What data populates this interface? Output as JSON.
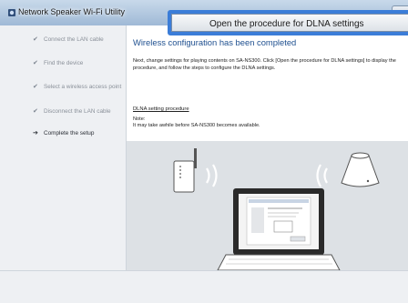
{
  "window": {
    "title": "Network Speaker Wi-Fi Utility",
    "icon": "app-speaker-icon"
  },
  "steps": [
    {
      "label": "Connect the LAN cable",
      "state": "done",
      "icon": "checkmark-icon"
    },
    {
      "label": "Find the device",
      "state": "done",
      "icon": "checkmark-icon"
    },
    {
      "label": "Select a wireless access point",
      "state": "done",
      "icon": "checkmark-icon"
    },
    {
      "label": "Disconnect the LAN cable",
      "state": "done",
      "icon": "checkmark-icon"
    },
    {
      "label": "Complete the setup",
      "state": "current",
      "icon": "arrow-right-icon"
    }
  ],
  "main": {
    "heading": "Wireless configuration has been completed",
    "paragraph": "Next, change settings for playing contents on SA-NS300. Click [Open the procedure for DLNA settings] to display the procedure, and follow the steps to configure the DLNA settings.",
    "link": "DLNA setting procedure",
    "note_label": "Note:",
    "note_text": "It may take awhile before SA-NS300 becomes available."
  },
  "buttons": {
    "open_dlna": "Open the procedure for DLNA settings"
  },
  "colors": {
    "heading": "#1e4f8f",
    "illustration_bg": "#dde1e5",
    "button_focus": "#3b7dd8"
  }
}
